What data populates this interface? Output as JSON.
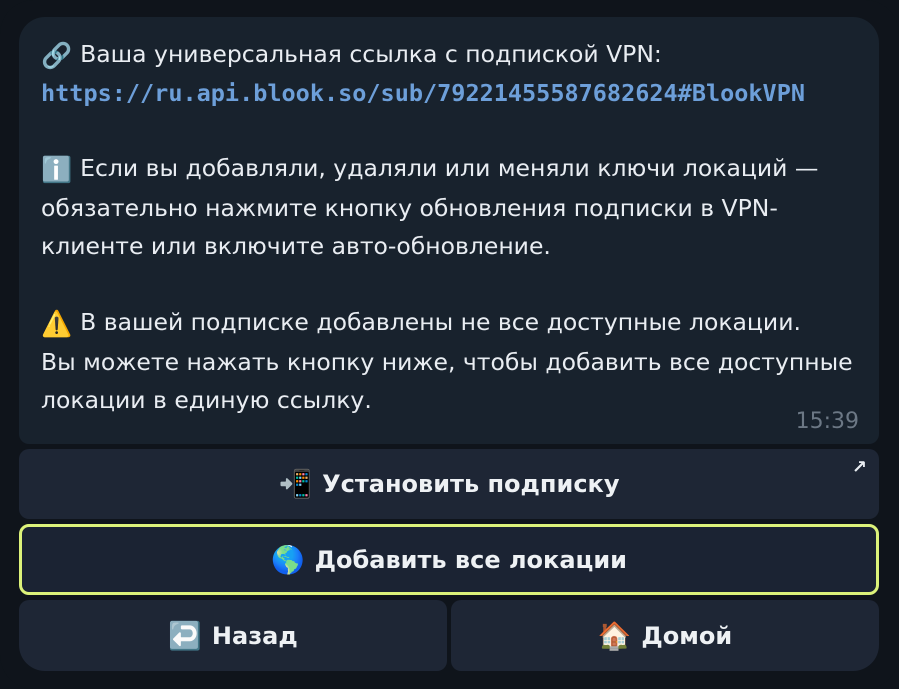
{
  "message": {
    "line1_emoji": "🔗",
    "line1_text": "Ваша универсальная ссылка с подпиской VPN:",
    "link": "https://ru.api.blook.so/sub/7922145558768262​4#BlookVPN",
    "info_emoji": "ℹ️",
    "info_line1": "Если вы добавляли, удаляли или меняли ключи локаций —",
    "info_line2": "обязательно нажмите кнопку обновления подписки в VPN-",
    "info_line3": "клиенте или включите авто-обновление.",
    "warn_emoji": "⚠️",
    "warn_line1": "В вашей подписке добавлены не все доступные локации.",
    "warn_line2": "Вы можете нажать кнопку ниже, чтобы добавить все доступные",
    "warn_line3": "локации в единую ссылку.",
    "time": "15:39"
  },
  "buttons": {
    "install": {
      "emoji": "📲",
      "label": "Установить подписку",
      "corner_icon": "↗"
    },
    "add_all": {
      "emoji": "🌎",
      "label": "Добавить все локации"
    },
    "back": {
      "emoji": "↩️",
      "label": "Назад"
    },
    "home": {
      "emoji": "🏠",
      "label": "Домой"
    }
  },
  "colors": {
    "message_bg": "#18222d",
    "button_bg": "#1e2635",
    "link": "#6d9fd9",
    "highlight_border": "#dcf27a"
  }
}
